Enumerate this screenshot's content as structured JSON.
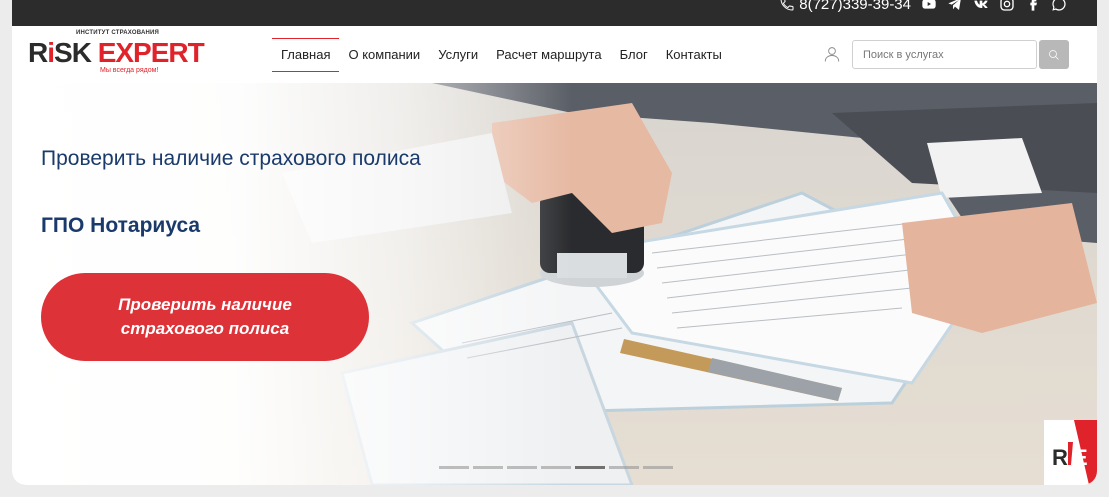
{
  "topbar": {
    "phone": "8(727)339-39-34",
    "social_icons": [
      "youtube-icon",
      "telegram-icon",
      "vk-icon",
      "instagram-icon",
      "facebook-icon",
      "whatsapp-icon"
    ]
  },
  "logo": {
    "subtitle": "ИНСТИТУТ СТРАХОВАНИЯ",
    "name_part1": "R",
    "name_part2": "SK ",
    "name_part3": "EXPERT",
    "slogan": "Мы всегда рядом!"
  },
  "nav": {
    "items": [
      {
        "label": "Главная",
        "active": true
      },
      {
        "label": "О компании"
      },
      {
        "label": "Услуги"
      },
      {
        "label": "Расчет маршрута"
      },
      {
        "label": "Блог"
      },
      {
        "label": "Контакты"
      }
    ]
  },
  "search": {
    "placeholder": "Поиск в услугах"
  },
  "hero": {
    "title": "Проверить наличие страхового полиса",
    "subtitle": "ГПО Нотариуса",
    "button_label": "Проверить наличие страхового полиса",
    "slides_total": 7,
    "active_slide": 5
  },
  "badge": {
    "text": "RiE"
  },
  "colors": {
    "accent_red": "#dc3238",
    "title_blue": "#1a3a6b",
    "topbar": "#2c2c2c"
  }
}
